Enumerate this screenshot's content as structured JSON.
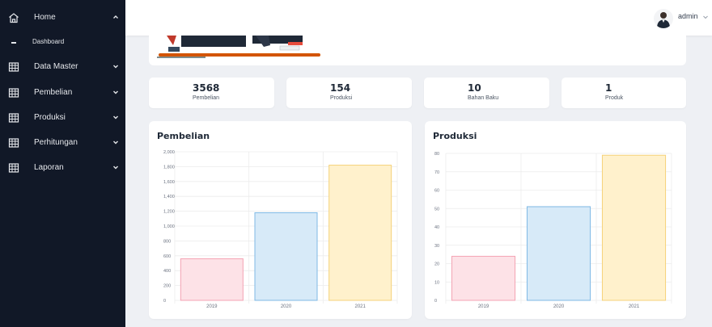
{
  "sidebar": {
    "items": [
      {
        "label": "Home",
        "icon": "home-icon",
        "chevron": "up"
      },
      {
        "label": "Data Master",
        "icon": "table-icon",
        "chevron": "down"
      },
      {
        "label": "Pembelian",
        "icon": "table-icon",
        "chevron": "down"
      },
      {
        "label": "Produksi",
        "icon": "table-icon",
        "chevron": "down"
      },
      {
        "label": "Perhitungan",
        "icon": "table-icon",
        "chevron": "down"
      },
      {
        "label": "Laporan",
        "icon": "table-icon",
        "chevron": "down"
      }
    ],
    "subitem": {
      "label": "Dashboard"
    }
  },
  "topbar": {
    "user": "admin"
  },
  "stats": [
    {
      "value": "3568",
      "label": "Pembelian"
    },
    {
      "value": "154",
      "label": "Produksi"
    },
    {
      "value": "10",
      "label": "Bahan Baku"
    },
    {
      "value": "1",
      "label": "Produk"
    }
  ],
  "colors": {
    "sidebar": "#111827",
    "bar_pink_fill": "#fde2e7",
    "bar_pink_stroke": "#f4a3b4",
    "bar_blue_fill": "#d7eaf8",
    "bar_blue_stroke": "#7fb8e4",
    "bar_yellow_fill": "#fff1cc",
    "bar_yellow_stroke": "#f5d27a"
  },
  "chart_data": [
    {
      "type": "bar",
      "title": "Pembelian",
      "categories": [
        "2019",
        "2020",
        "2021"
      ],
      "values": [
        560,
        1180,
        1820
      ],
      "ylim": [
        0,
        2000
      ],
      "yticks": [
        "0",
        "200",
        "400",
        "600",
        "800",
        "1,000",
        "1,200",
        "1,400",
        "1,600",
        "1,800",
        "2,000"
      ],
      "grid": true,
      "legend": "none"
    },
    {
      "type": "bar",
      "title": "Produksi",
      "categories": [
        "2019",
        "2020",
        "2021"
      ],
      "values": [
        24,
        51,
        79
      ],
      "ylim": [
        0,
        80
      ],
      "yticks": [
        "0",
        "10",
        "20",
        "30",
        "40",
        "50",
        "60",
        "70",
        "80"
      ],
      "grid": true,
      "legend": "none"
    }
  ]
}
